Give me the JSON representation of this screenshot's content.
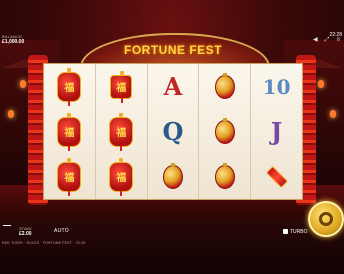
{
  "game": {
    "title": "FORTUNE FEST"
  },
  "header": {
    "balance_label": "BALANCE",
    "balance_value": "£1,000.00",
    "time": "22:28",
    "icons": [
      "speaker-icon",
      "fullscreen-icon",
      "menu-icon"
    ],
    "icon_glyphs": [
      "◀",
      "⤢",
      "≡"
    ]
  },
  "reels": [
    [
      "fu-lantern",
      "fu-lantern",
      "fu-lantern"
    ],
    [
      "letter-A",
      "fu-lantern",
      "fu-lantern"
    ],
    [
      "letter-A",
      "letter-Q",
      "ornament"
    ],
    [
      "ornament",
      "ornament",
      "ornament"
    ],
    [
      "letter-10",
      "letter-J",
      "firecracker"
    ]
  ],
  "reels_display": [
    [
      {
        "type": "fuk",
        "text": "福"
      },
      {
        "type": "fuk",
        "text": "福"
      },
      {
        "type": "fuk",
        "text": "福"
      }
    ],
    [
      {
        "type": "fuk-plain",
        "text": "福"
      },
      {
        "type": "fuk",
        "text": "福"
      },
      {
        "type": "fuk",
        "text": "福"
      }
    ],
    [
      {
        "type": "letter",
        "cls": "A",
        "text": "A"
      },
      {
        "type": "letter",
        "cls": "Q",
        "text": "Q"
      },
      {
        "type": "ornament",
        "text": ""
      }
    ],
    [
      {
        "type": "ornament",
        "text": ""
      },
      {
        "type": "ornament",
        "text": ""
      },
      {
        "type": "ornament",
        "text": ""
      }
    ],
    [
      {
        "type": "letter",
        "cls": "T",
        "text": "10"
      },
      {
        "type": "letter",
        "cls": "J",
        "text": "J"
      },
      {
        "type": "firecracker",
        "text": ""
      }
    ]
  ],
  "controls": {
    "stake_label": "STAKE",
    "stake_value": "£2.00",
    "auto_label": "AUTO",
    "turbo_label": "TURBO"
  },
  "footer": {
    "text": "RED TIGER · RULES · FORTUNE FEST · 22:28"
  },
  "colors": {
    "accent": "#ffd24a",
    "spin": "#e0a820",
    "frame": "#c9a060"
  }
}
